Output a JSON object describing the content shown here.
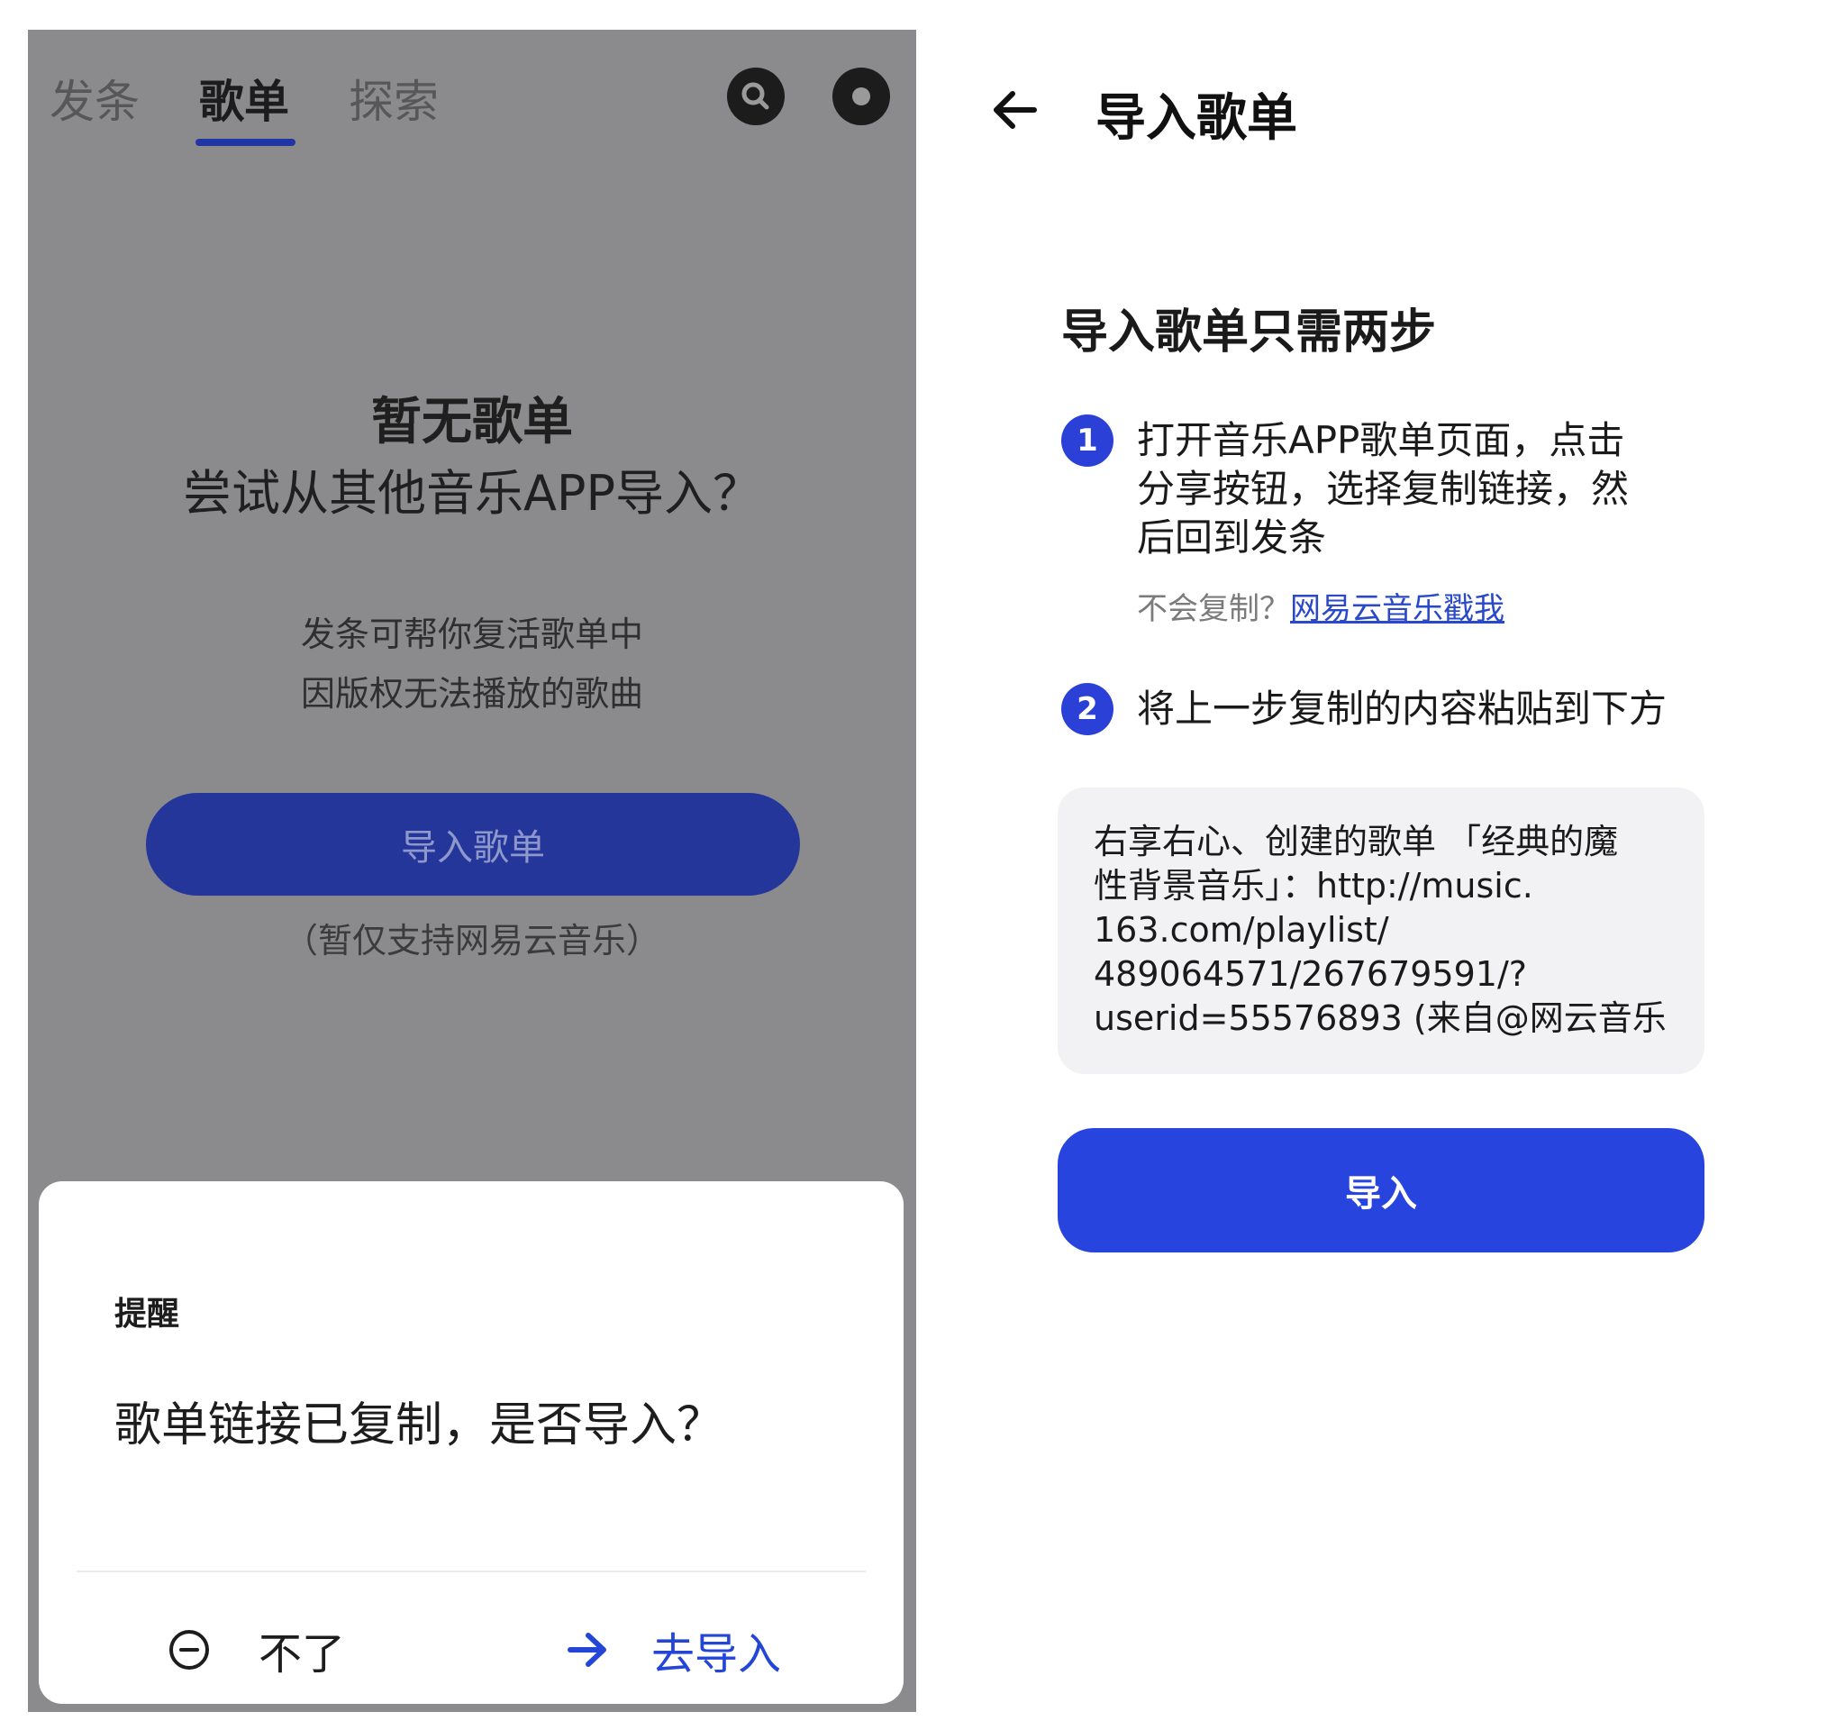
{
  "left_screen": {
    "tabs": [
      {
        "label": "发条",
        "active": false
      },
      {
        "label": "歌单",
        "active": true
      },
      {
        "label": "探索",
        "active": false
      }
    ],
    "header_icons": [
      "search-icon",
      "record-icon"
    ],
    "empty_state": {
      "title_line1": "暂无歌单",
      "title_line2": "尝试从其他音乐APP导入？",
      "desc_line1": "发条可帮你复活歌单中",
      "desc_line2": "因版权无法播放的歌曲"
    },
    "import_button": "导入歌单",
    "support_note": "（暂仅支持网易云音乐）",
    "dialog": {
      "title": "提醒",
      "message": "歌单链接已复制，是否导入？",
      "cancel_label": "不了",
      "cancel_icon": "minus-circle-icon",
      "confirm_label": "去导入",
      "confirm_icon": "arrow-right-icon"
    }
  },
  "right_screen": {
    "title": "导入歌单",
    "steps_heading": "导入歌单只需两步",
    "steps": [
      {
        "number": "1",
        "lines": [
          "打开音乐APP歌单页面，点击",
          "分享按钮，选择复制链接，然",
          "后回到发条"
        ]
      },
      {
        "number": "2",
        "lines": [
          "将上一步复制的内容粘贴到下方"
        ]
      }
    ],
    "help_prefix": "不会复制？",
    "help_link": "网易云音乐戳我",
    "paste_lines": [
      "右享右心、创建的歌单 「经典的魔",
      "性背景音乐」：http://music.",
      "163.com/playlist/",
      "489064571/267679591/?",
      "userid=55576893 (来自@网云音乐"
    ],
    "import_button": "导入"
  },
  "colors": {
    "overlay_gray": "#8b8b8d",
    "primary_blue": "#2744df",
    "dim_button_blue": "#25369a",
    "link_blue": "#2a49c9"
  }
}
